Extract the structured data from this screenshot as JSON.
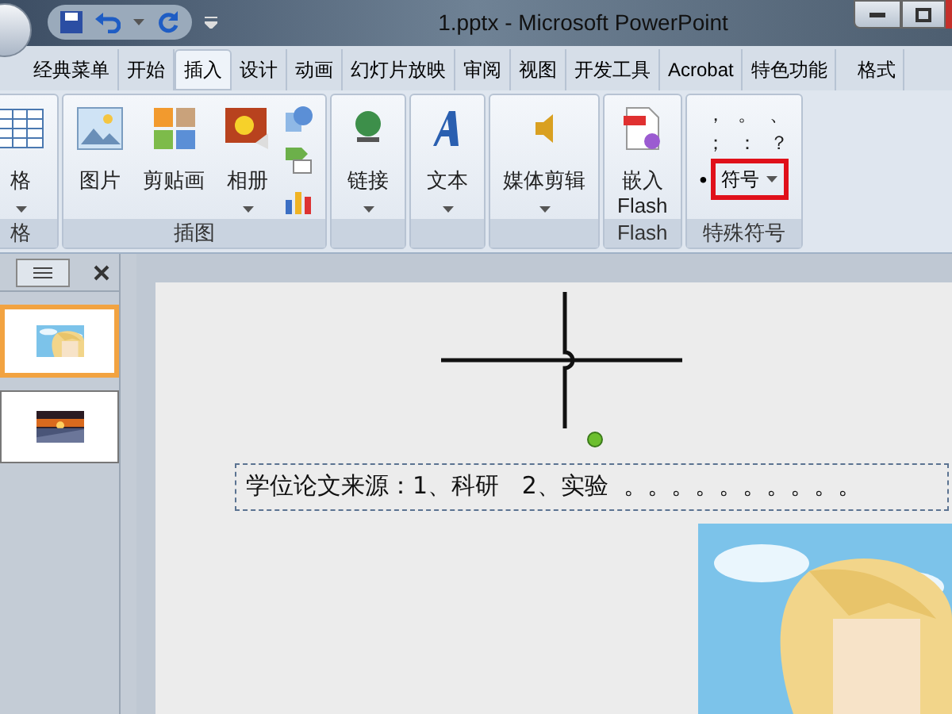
{
  "window": {
    "title": "1.pptx - Microsoft PowerPoint"
  },
  "tabs": [
    {
      "label": "经典菜单",
      "selected": false
    },
    {
      "label": "开始",
      "selected": false
    },
    {
      "label": "插入",
      "selected": true
    },
    {
      "label": "设计",
      "selected": false
    },
    {
      "label": "动画",
      "selected": false
    },
    {
      "label": "幻灯片放映",
      "selected": false
    },
    {
      "label": "审阅",
      "selected": false
    },
    {
      "label": "视图",
      "selected": false
    },
    {
      "label": "开发工具",
      "selected": false
    },
    {
      "label": "Acrobat",
      "selected": false
    },
    {
      "label": "特色功能",
      "selected": false
    },
    {
      "label": "格式",
      "selected": false
    }
  ],
  "ribbon": {
    "groups": [
      {
        "label": "格",
        "items": [
          {
            "kind": "large",
            "label": "格",
            "dropdown": true
          }
        ]
      },
      {
        "label": "插图",
        "items": [
          {
            "kind": "large",
            "label": "图片",
            "dropdown": false
          },
          {
            "kind": "large",
            "label": "剪贴画",
            "dropdown": false
          },
          {
            "kind": "large",
            "label": "相册",
            "dropdown": true
          },
          {
            "kind": "stack"
          }
        ]
      },
      {
        "items": [
          {
            "kind": "large",
            "label": "链接",
            "dropdown": true
          }
        ]
      },
      {
        "items": [
          {
            "kind": "large",
            "label": "文本",
            "dropdown": true
          }
        ]
      },
      {
        "items": [
          {
            "kind": "large",
            "label": "媒体剪辑",
            "dropdown": true
          }
        ]
      },
      {
        "label": "Flash",
        "items": [
          {
            "kind": "large",
            "label": "嵌入 Flash",
            "dropdown": false
          }
        ]
      },
      {
        "label": "特殊符号",
        "items": [
          {
            "kind": "symbols",
            "symbols": [
              "，",
              "。",
              "、",
              "；",
              "：",
              "？",
              "•"
            ],
            "button": {
              "label": "符号",
              "highlighted": true
            }
          }
        ]
      }
    ]
  },
  "slides": [
    {
      "selected": true
    },
    {
      "selected": false
    }
  ],
  "slide": {
    "text": "学位论文来源：1、科研   2、实验  。。。。。。。。。。"
  }
}
